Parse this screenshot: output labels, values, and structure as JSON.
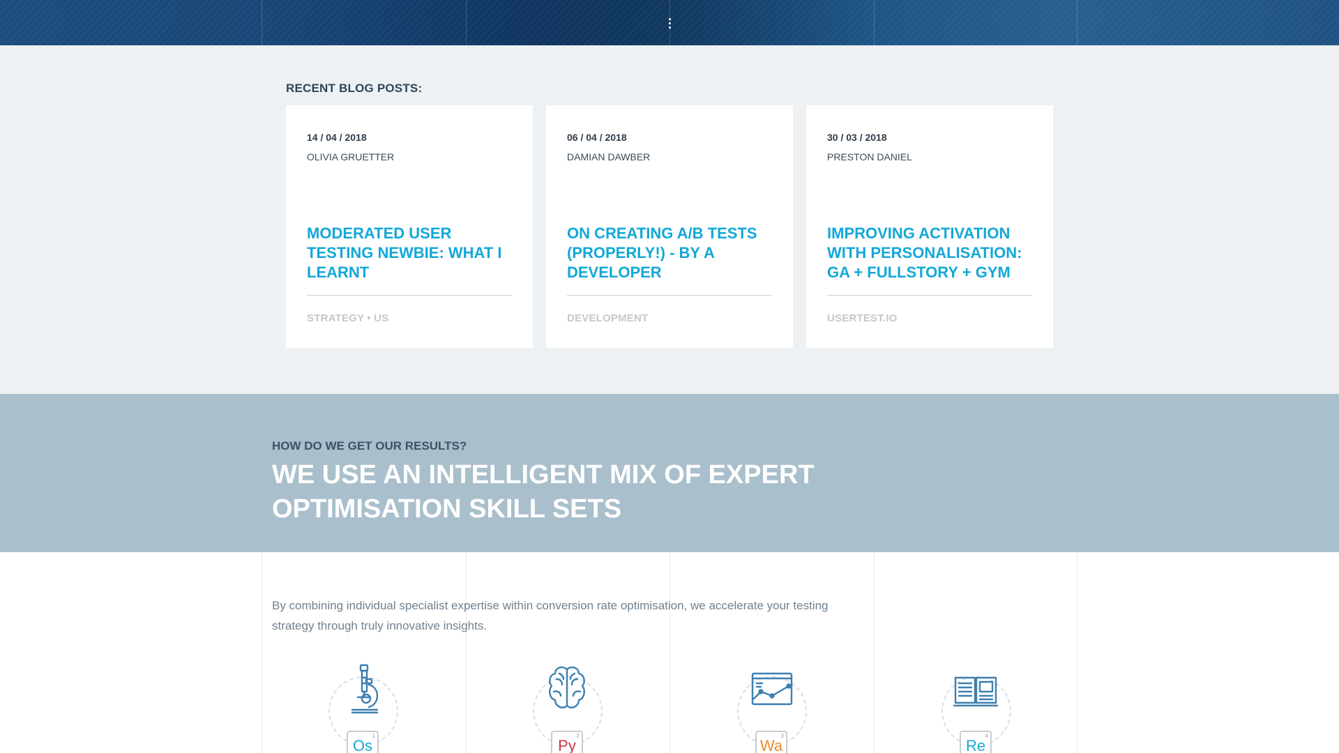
{
  "blog": {
    "heading": "RECENT BLOG POSTS:",
    "posts": [
      {
        "date": "14 / 04 / 2018",
        "author": "OLIVIA GRUETTER",
        "title": "MODERATED USER TESTING NEWBIE: WHAT I LEARNT",
        "tags": "STRATEGY • US"
      },
      {
        "date": "06 / 04 / 2018",
        "author": "DAMIAN DAWBER",
        "title": "ON CREATING A/B TESTS (PROPERLY!) - BY A DEVELOPER",
        "tags": "DEVELOPMENT"
      },
      {
        "date": "30 / 03 / 2018",
        "author": "PRESTON DANIEL",
        "title": "IMPROVING ACTIVATION WITH PERSONALISATION: GA + FULLSTORY + GYM",
        "tags": "USERTEST.IO"
      }
    ]
  },
  "results": {
    "kicker": "HOW DO WE GET OUR RESULTS?",
    "headline": "WE USE AN INTELLIGENT MIX OF EXPERT OPTIMISATION SKILL SETS"
  },
  "skills": {
    "intro": "By combining individual specialist expertise within conversion rate optimisation, we accelerate your testing strategy through truly innovative insights.",
    "items": [
      {
        "icon": "microscope-icon",
        "symbol": "Os",
        "number": "1",
        "color": "#19a9d2"
      },
      {
        "icon": "brain-icon",
        "symbol": "Py",
        "number": "2",
        "color": "#c8364a"
      },
      {
        "icon": "chart-window-icon",
        "symbol": "Wa",
        "number": "3",
        "color": "#ee8a2b"
      },
      {
        "icon": "book-icon",
        "symbol": "Re",
        "number": "4",
        "color": "#19a9d2"
      }
    ]
  },
  "colors": {
    "accent": "#12a8d8",
    "hero": "#11385f",
    "band": "#a9bfcc",
    "line_icon": "#3c7fb0"
  }
}
